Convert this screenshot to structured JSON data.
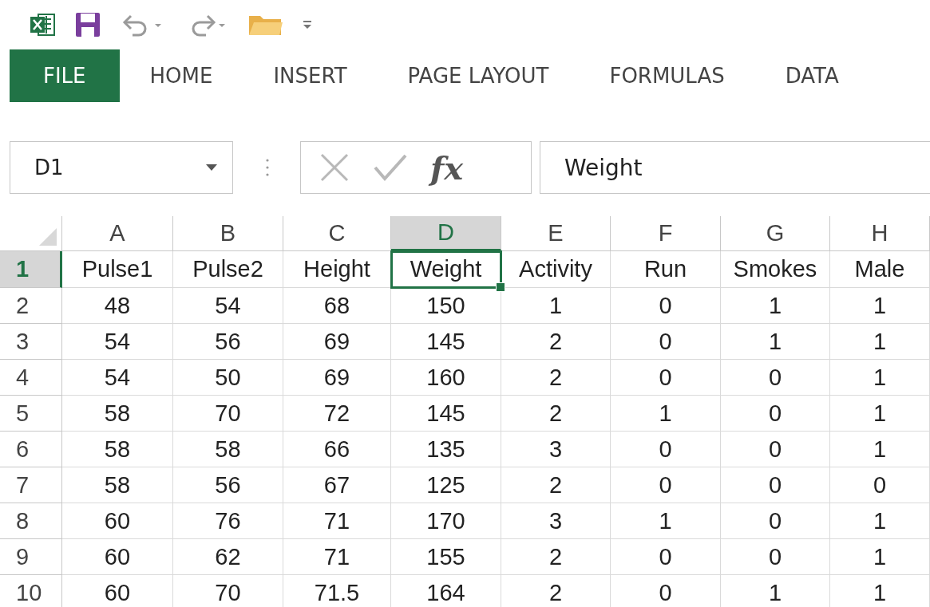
{
  "ribbon_tabs": [
    {
      "label": "FILE",
      "selected": true
    },
    {
      "label": "HOME",
      "selected": false
    },
    {
      "label": "INSERT",
      "selected": false
    },
    {
      "label": "PAGE LAYOUT",
      "selected": false
    },
    {
      "label": "FORMULAS",
      "selected": false
    },
    {
      "label": "DATA",
      "selected": false
    }
  ],
  "name_box": {
    "value": "D1"
  },
  "formula_bar": {
    "fx_label": "fx",
    "value": "Weight"
  },
  "sheet": {
    "columns": [
      {
        "label": "A",
        "selected": false
      },
      {
        "label": "B",
        "selected": false
      },
      {
        "label": "C",
        "selected": false
      },
      {
        "label": "D",
        "selected": true
      },
      {
        "label": "E",
        "selected": false
      },
      {
        "label": "F",
        "selected": false
      },
      {
        "label": "G",
        "selected": false
      },
      {
        "label": "H",
        "selected": false
      }
    ],
    "rows": [
      {
        "label": "1",
        "selected": true,
        "cells": [
          {
            "text": "Pulse1",
            "selected": false
          },
          {
            "text": "Pulse2",
            "selected": false
          },
          {
            "text": "Height",
            "selected": false
          },
          {
            "text": "Weight",
            "selected": true
          },
          {
            "text": "Activity",
            "selected": false
          },
          {
            "text": "Run",
            "selected": false
          },
          {
            "text": "Smokes",
            "selected": false
          },
          {
            "text": "Male",
            "selected": false
          }
        ]
      },
      {
        "label": "2",
        "selected": false,
        "cells": [
          {
            "text": "48",
            "selected": false
          },
          {
            "text": "54",
            "selected": false
          },
          {
            "text": "68",
            "selected": false
          },
          {
            "text": "150",
            "selected": false
          },
          {
            "text": "1",
            "selected": false
          },
          {
            "text": "0",
            "selected": false
          },
          {
            "text": "1",
            "selected": false
          },
          {
            "text": "1",
            "selected": false
          }
        ]
      },
      {
        "label": "3",
        "selected": false,
        "cells": [
          {
            "text": "54",
            "selected": false
          },
          {
            "text": "56",
            "selected": false
          },
          {
            "text": "69",
            "selected": false
          },
          {
            "text": "145",
            "selected": false
          },
          {
            "text": "2",
            "selected": false
          },
          {
            "text": "0",
            "selected": false
          },
          {
            "text": "1",
            "selected": false
          },
          {
            "text": "1",
            "selected": false
          }
        ]
      },
      {
        "label": "4",
        "selected": false,
        "cells": [
          {
            "text": "54",
            "selected": false
          },
          {
            "text": "50",
            "selected": false
          },
          {
            "text": "69",
            "selected": false
          },
          {
            "text": "160",
            "selected": false
          },
          {
            "text": "2",
            "selected": false
          },
          {
            "text": "0",
            "selected": false
          },
          {
            "text": "0",
            "selected": false
          },
          {
            "text": "1",
            "selected": false
          }
        ]
      },
      {
        "label": "5",
        "selected": false,
        "cells": [
          {
            "text": "58",
            "selected": false
          },
          {
            "text": "70",
            "selected": false
          },
          {
            "text": "72",
            "selected": false
          },
          {
            "text": "145",
            "selected": false
          },
          {
            "text": "2",
            "selected": false
          },
          {
            "text": "1",
            "selected": false
          },
          {
            "text": "0",
            "selected": false
          },
          {
            "text": "1",
            "selected": false
          }
        ]
      },
      {
        "label": "6",
        "selected": false,
        "cells": [
          {
            "text": "58",
            "selected": false
          },
          {
            "text": "58",
            "selected": false
          },
          {
            "text": "66",
            "selected": false
          },
          {
            "text": "135",
            "selected": false
          },
          {
            "text": "3",
            "selected": false
          },
          {
            "text": "0",
            "selected": false
          },
          {
            "text": "0",
            "selected": false
          },
          {
            "text": "1",
            "selected": false
          }
        ]
      },
      {
        "label": "7",
        "selected": false,
        "cells": [
          {
            "text": "58",
            "selected": false
          },
          {
            "text": "56",
            "selected": false
          },
          {
            "text": "67",
            "selected": false
          },
          {
            "text": "125",
            "selected": false
          },
          {
            "text": "2",
            "selected": false
          },
          {
            "text": "0",
            "selected": false
          },
          {
            "text": "0",
            "selected": false
          },
          {
            "text": "0",
            "selected": false
          }
        ]
      },
      {
        "label": "8",
        "selected": false,
        "cells": [
          {
            "text": "60",
            "selected": false
          },
          {
            "text": "76",
            "selected": false
          },
          {
            "text": "71",
            "selected": false
          },
          {
            "text": "170",
            "selected": false
          },
          {
            "text": "3",
            "selected": false
          },
          {
            "text": "1",
            "selected": false
          },
          {
            "text": "0",
            "selected": false
          },
          {
            "text": "1",
            "selected": false
          }
        ]
      },
      {
        "label": "9",
        "selected": false,
        "cells": [
          {
            "text": "60",
            "selected": false
          },
          {
            "text": "62",
            "selected": false
          },
          {
            "text": "71",
            "selected": false
          },
          {
            "text": "155",
            "selected": false
          },
          {
            "text": "2",
            "selected": false
          },
          {
            "text": "0",
            "selected": false
          },
          {
            "text": "0",
            "selected": false
          },
          {
            "text": "1",
            "selected": false
          }
        ]
      },
      {
        "label": "10",
        "selected": false,
        "cells": [
          {
            "text": "60",
            "selected": false
          },
          {
            "text": "70",
            "selected": false
          },
          {
            "text": "71.5",
            "selected": false
          },
          {
            "text": "164",
            "selected": false
          },
          {
            "text": "2",
            "selected": false
          },
          {
            "text": "0",
            "selected": false
          },
          {
            "text": "1",
            "selected": false
          },
          {
            "text": "1",
            "selected": false
          }
        ]
      }
    ]
  }
}
